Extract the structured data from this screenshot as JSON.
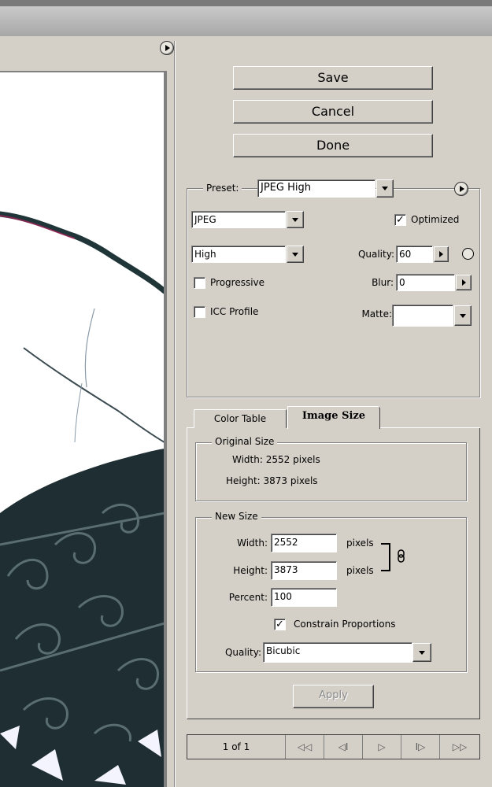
{
  "actions": {
    "save": "Save",
    "cancel": "Cancel",
    "done": "Done"
  },
  "preset": {
    "label": "Preset:",
    "value": "JPEG High"
  },
  "format": {
    "value": "JPEG"
  },
  "quality_level": {
    "value": "High"
  },
  "optimized": {
    "label": "Optimized",
    "checked": true
  },
  "quality": {
    "label": "Quality:",
    "value": "60"
  },
  "progressive": {
    "label": "Progressive",
    "checked": false
  },
  "blur": {
    "label": "Blur:",
    "value": "0"
  },
  "icc_profile": {
    "label": "ICC Profile",
    "checked": false
  },
  "matte": {
    "label": "Matte:",
    "value": ""
  },
  "tabs": [
    {
      "label": "Color Table",
      "active": false
    },
    {
      "label": "Image Size",
      "active": true
    }
  ],
  "original_size": {
    "legend": "Original Size",
    "width_text": "Width: 2552 pixels",
    "height_text": "Height: 3873 pixels"
  },
  "new_size": {
    "legend": "New Size",
    "width_label": "Width:",
    "width_value": "2552",
    "height_label": "Height:",
    "height_value": "3873",
    "unit": "pixels",
    "percent_label": "Percent:",
    "percent_value": "100",
    "constrain_label": "Constrain Proportions",
    "constrain_checked": true,
    "quality_label": "Quality:",
    "quality_value": "Bicubic"
  },
  "apply": "Apply",
  "nav": {
    "page": "1 of 1",
    "first": "◁◁",
    "prev": "◁I",
    "play": "▷",
    "next": "I▷",
    "last": "▷▷"
  }
}
